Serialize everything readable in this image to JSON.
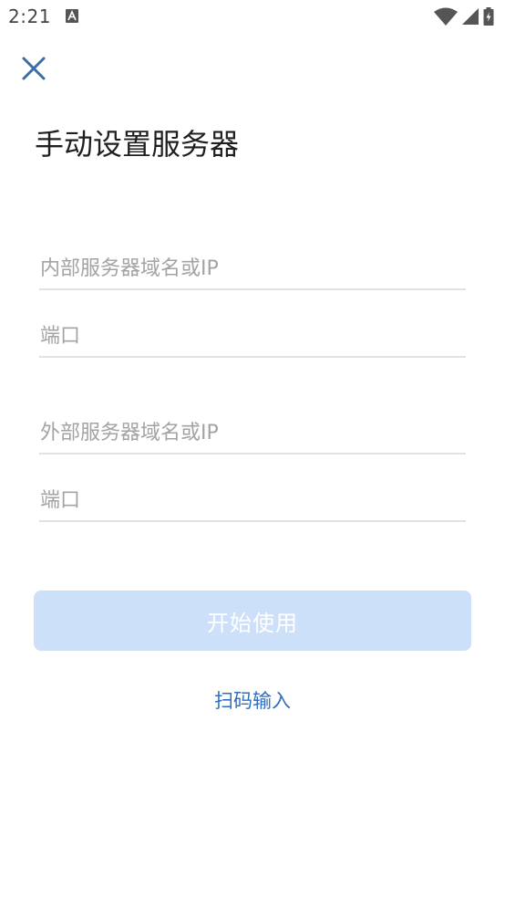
{
  "status_bar": {
    "time": "2:21",
    "app_icon": "text-a-icon",
    "icons": [
      "wifi-icon",
      "cellular-signal-icon",
      "battery-charging-icon"
    ]
  },
  "header": {
    "close_icon": "close-icon",
    "title": "手动设置服务器"
  },
  "form": {
    "internal_host": {
      "placeholder": "内部服务器域名或IP",
      "value": ""
    },
    "internal_port": {
      "placeholder": "端口",
      "value": ""
    },
    "external_host": {
      "placeholder": "外部服务器域名或IP",
      "value": ""
    },
    "external_port": {
      "placeholder": "端口",
      "value": ""
    }
  },
  "actions": {
    "start_label": "开始使用",
    "start_enabled": false,
    "scan_label": "扫码输入"
  },
  "colors": {
    "accent": "#2f6fbf",
    "button_disabled_bg": "#cde0f9",
    "close_icon": "#3a6ea8",
    "placeholder": "#a3a3a3",
    "divider": "#e2e2e2"
  }
}
